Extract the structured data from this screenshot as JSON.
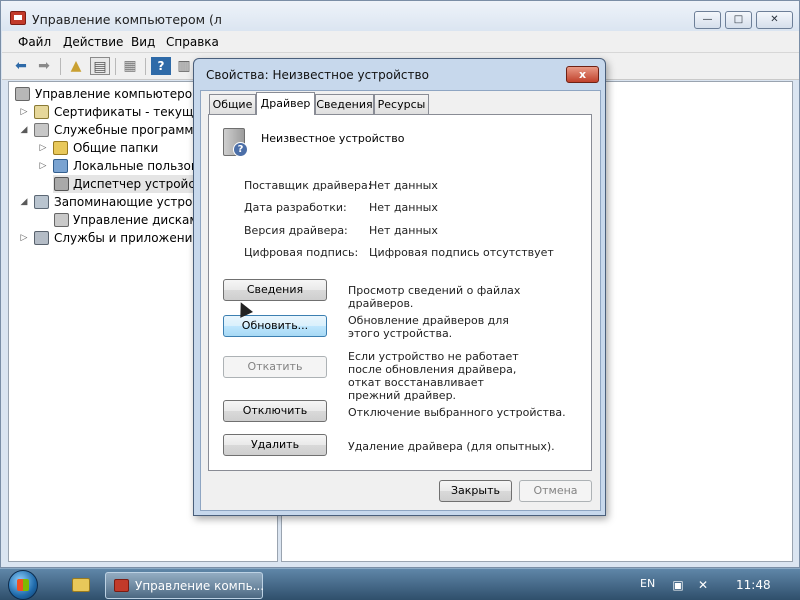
{
  "window": {
    "title": "Управление компьютером (л",
    "minimize": "—",
    "maximize": "□",
    "close": "✕"
  },
  "menu": [
    "Файл",
    "Действие",
    "Вид",
    "Справка"
  ],
  "toolbar": {
    "icons": [
      "back-arrow-icon",
      "forward-arrow-icon",
      "folder-up-icon",
      "show-hide-tree-icon",
      "properties-icon",
      "help-icon",
      "view-icon"
    ]
  },
  "tree": [
    {
      "label": "Управление компьютером (л",
      "arrow": ""
    },
    {
      "label": "Сертификаты - текущий п",
      "arrow": "▷"
    },
    {
      "label": "Служебные программы",
      "arrow": "◢"
    },
    {
      "label": "Общие папки",
      "arrow": "▷"
    },
    {
      "label": "Локальные пользовате",
      "arrow": "▷"
    },
    {
      "label": "Диспетчер устройств",
      "arrow": ""
    },
    {
      "label": "Запоминающие устройст",
      "arrow": "◢"
    },
    {
      "label": "Управление дисками",
      "arrow": ""
    },
    {
      "label": "Службы и приложения",
      "arrow": "▷"
    }
  ],
  "dialog": {
    "title": "Свойства: Неизвестное устройство",
    "close": "x",
    "tabs": [
      "Общие",
      "Драйвер",
      "Сведения",
      "Ресурсы"
    ],
    "active_tab": "Драйвер",
    "device_name": "Неизвестное устройство",
    "properties": [
      {
        "label": "Поставщик драйвера:",
        "value": "Нет данных"
      },
      {
        "label": "Дата разработки:",
        "value": "Нет данных"
      },
      {
        "label": "Версия драйвера:",
        "value": "Нет данных"
      },
      {
        "label": "Цифровая подпись:",
        "value": "Цифровая подпись отсутствует"
      }
    ],
    "actions": [
      {
        "button": "Сведения",
        "desc": "Просмотр сведений о файлах драйверов."
      },
      {
        "button": "Обновить...",
        "desc": "Обновление драйверов для этого устройства."
      },
      {
        "button": "Откатить",
        "desc": "Если устройство не работает после обновления драйвера, откат восстанавливает прежний драйвер."
      },
      {
        "button": "Отключить",
        "desc": "Отключение выбранного устройства."
      },
      {
        "button": "Удалить",
        "desc": "Удаление драйвера (для опытных)."
      }
    ],
    "ok": "Закрыть",
    "cancel": "Отмена"
  },
  "taskbar": {
    "task_label": "Управление компь...",
    "language": "EN",
    "time": "11:48"
  }
}
